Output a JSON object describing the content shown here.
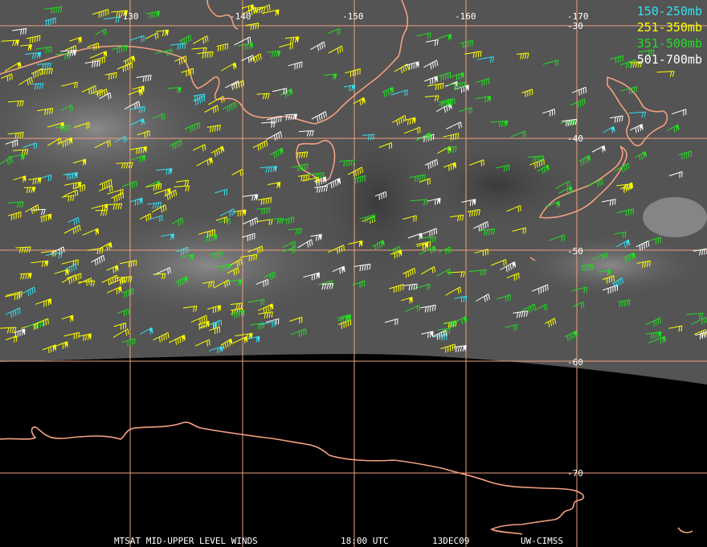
{
  "legend": [
    {
      "label": "150-250mb",
      "color": "#33e0f0"
    },
    {
      "label": "251-350mb",
      "color": "#ffff00"
    },
    {
      "label": "351-500mb",
      "color": "#22dd22"
    },
    {
      "label": "501-700mb",
      "color": "#ffffff"
    }
  ],
  "lon_labels": [
    "-130",
    "-140",
    "-150",
    "-160",
    "-170"
  ],
  "lat_labels": [
    "-30",
    "-40",
    "-50",
    "-60",
    "-70"
  ],
  "footer": {
    "title": "MTSAT MID-UPPER LEVEL WINDS",
    "time": "18:00 UTC",
    "date": "13DEC09",
    "source": "UW-CIMSS"
  },
  "colors": {
    "grid": "#f0a080",
    "coast": "#f4a080",
    "background_cloud": "#555555",
    "space": "#000000"
  }
}
